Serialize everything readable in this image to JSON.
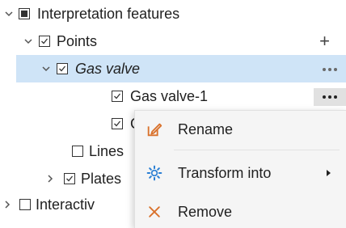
{
  "tree": {
    "items": [
      {
        "label": "Interpretation features",
        "icon": "chevron-down-icon",
        "check": "indeterminate"
      },
      {
        "label": "Points",
        "icon": "chevron-down-icon",
        "check": "checked",
        "action": "+"
      },
      {
        "label": "Gas valve",
        "icon": "chevron-down-icon",
        "check": "checked",
        "selected": true
      },
      {
        "label": "Gas valve-1",
        "check": "checked"
      },
      {
        "label": "G",
        "check": "checked"
      },
      {
        "label": "Lines",
        "check": "unchecked"
      },
      {
        "label": "Plates",
        "icon": "chevron-right-icon",
        "check": "checked"
      },
      {
        "label": "Interactiv",
        "icon": "chevron-right-icon",
        "check": "unchecked"
      }
    ]
  },
  "context_menu": {
    "items": [
      {
        "label": "Rename",
        "icon": "rename-icon",
        "icon_color": "#d9712b"
      },
      {
        "label": "Transform into",
        "icon": "transform-icon",
        "icon_color": "#2a7fd4"
      },
      {
        "label": "Remove",
        "icon": "close-icon",
        "icon_color": "#d9712b"
      }
    ]
  }
}
